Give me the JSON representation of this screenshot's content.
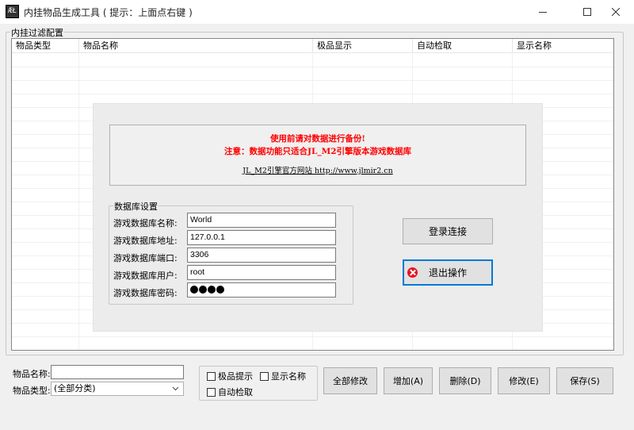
{
  "window": {
    "icon_text": "ÆŁ",
    "title": "内挂物品生成工具 ( 提示：上面点右键 )"
  },
  "filter_group": {
    "legend": "内挂过滤配置"
  },
  "grid": {
    "columns": [
      "物品类型",
      "物品名称",
      "极品显示",
      "自动检取",
      "显示名称"
    ]
  },
  "notice": {
    "line1": "使用前请对数据进行备份!",
    "line2": "注意：数据功能只适合JL_M2引擎版本游戏数据库",
    "line3": "JL_M2引擎官方网站  http://www.jlmir2.cn"
  },
  "db": {
    "legend": "数据库设置",
    "name_label": "游戏数据库名称:",
    "name_value": "World",
    "addr_label": "游戏数据库地址:",
    "addr_value": "127.0.0.1",
    "port_label": "游戏数据库端口:",
    "port_value": "3306",
    "user_label": "游戏数据库用户:",
    "user_value": "root",
    "pass_label": "游戏数据库密码:",
    "pass_dots": 4
  },
  "buttons": {
    "login": "登录连接",
    "exit": "退出操作",
    "modify_all": "全部修改",
    "add": "增加(A)",
    "delete": "删除(D)",
    "edit": "修改(E)",
    "save": "保存(S)"
  },
  "bottom": {
    "item_name_label": "物品名称:",
    "item_name_value": "",
    "item_type_label": "物品类型:",
    "item_type_selected": "(全部分类)",
    "chk_fine": "极品提示",
    "chk_showname": "显示名称",
    "chk_autopick": "自动检取"
  }
}
